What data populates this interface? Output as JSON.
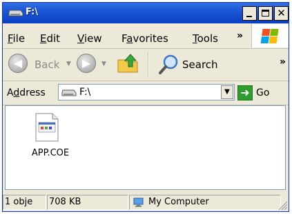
{
  "window": {
    "title": "F:\\",
    "controls": {
      "minimize": "_",
      "maximize": "□",
      "close": "✕"
    }
  },
  "menu": {
    "items": [
      {
        "prefix": "",
        "accel": "F",
        "rest": "ile"
      },
      {
        "prefix": "",
        "accel": "E",
        "rest": "dit"
      },
      {
        "prefix": "",
        "accel": "V",
        "rest": "iew"
      },
      {
        "prefix": "F",
        "accel": "a",
        "rest": "vorites"
      },
      {
        "prefix": "",
        "accel": "T",
        "rest": "ools"
      }
    ],
    "overflow": "»"
  },
  "toolbar": {
    "back_label": "Back",
    "search_label": "Search",
    "overflow": "»"
  },
  "address": {
    "label_accel": "d",
    "label_prefix": "A",
    "label_rest": "dress",
    "value": "F:\\",
    "go_label": "Go"
  },
  "files": [
    {
      "name": "APP.COE",
      "icon": "file-icon"
    }
  ],
  "status": {
    "objects": "1 obje",
    "size": "708 KB",
    "zone": "My Computer"
  },
  "colors": {
    "title_bar": "#1a57d6",
    "window_bg": "#ece9d8",
    "go_button": "#2d9e2d"
  }
}
